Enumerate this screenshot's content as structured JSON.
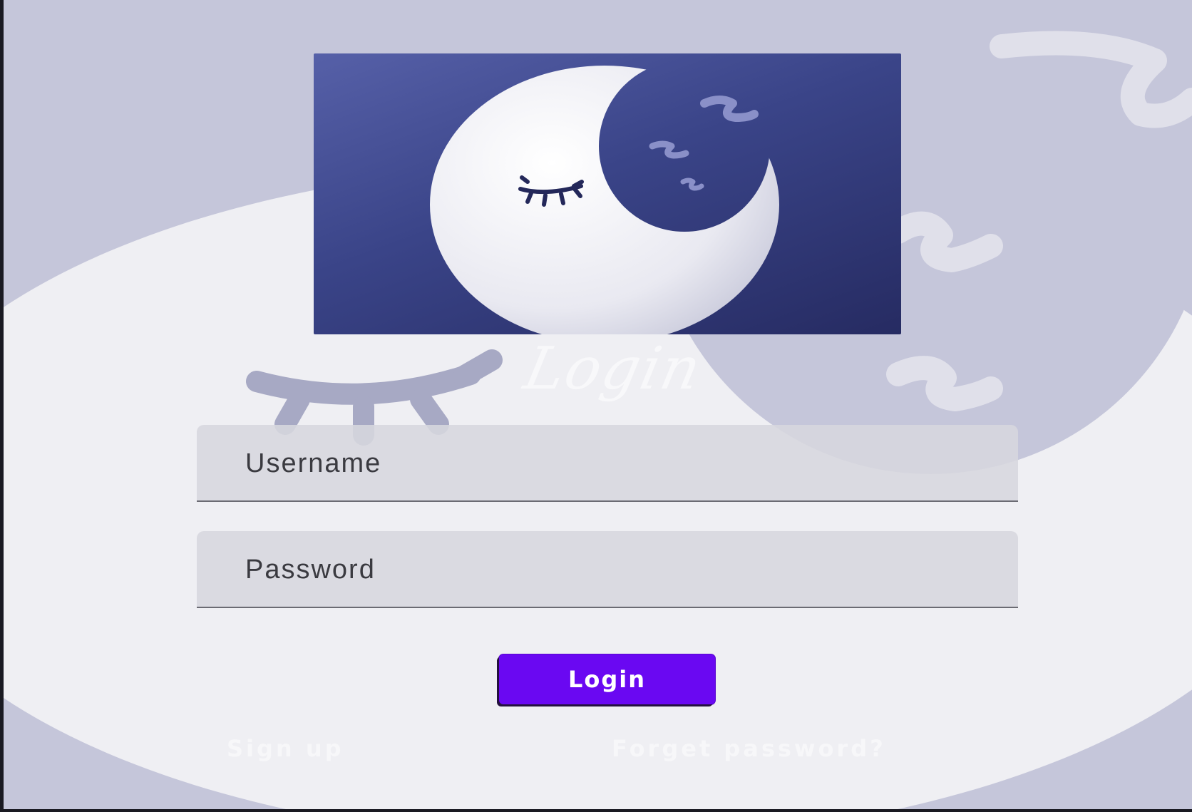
{
  "form": {
    "title": "Login",
    "username_placeholder": "Username",
    "password_placeholder": "Password",
    "login_label": "Login"
  },
  "links": {
    "signup": "Sign up",
    "forgot_password": "Forget password?"
  },
  "logo": {
    "icon": "sleeping-moon-icon"
  },
  "colors": {
    "background": "#c5c6da",
    "logo_tile": "#3a4488",
    "login_button": "#6a08f2",
    "field_fill": "#d7d7de"
  }
}
